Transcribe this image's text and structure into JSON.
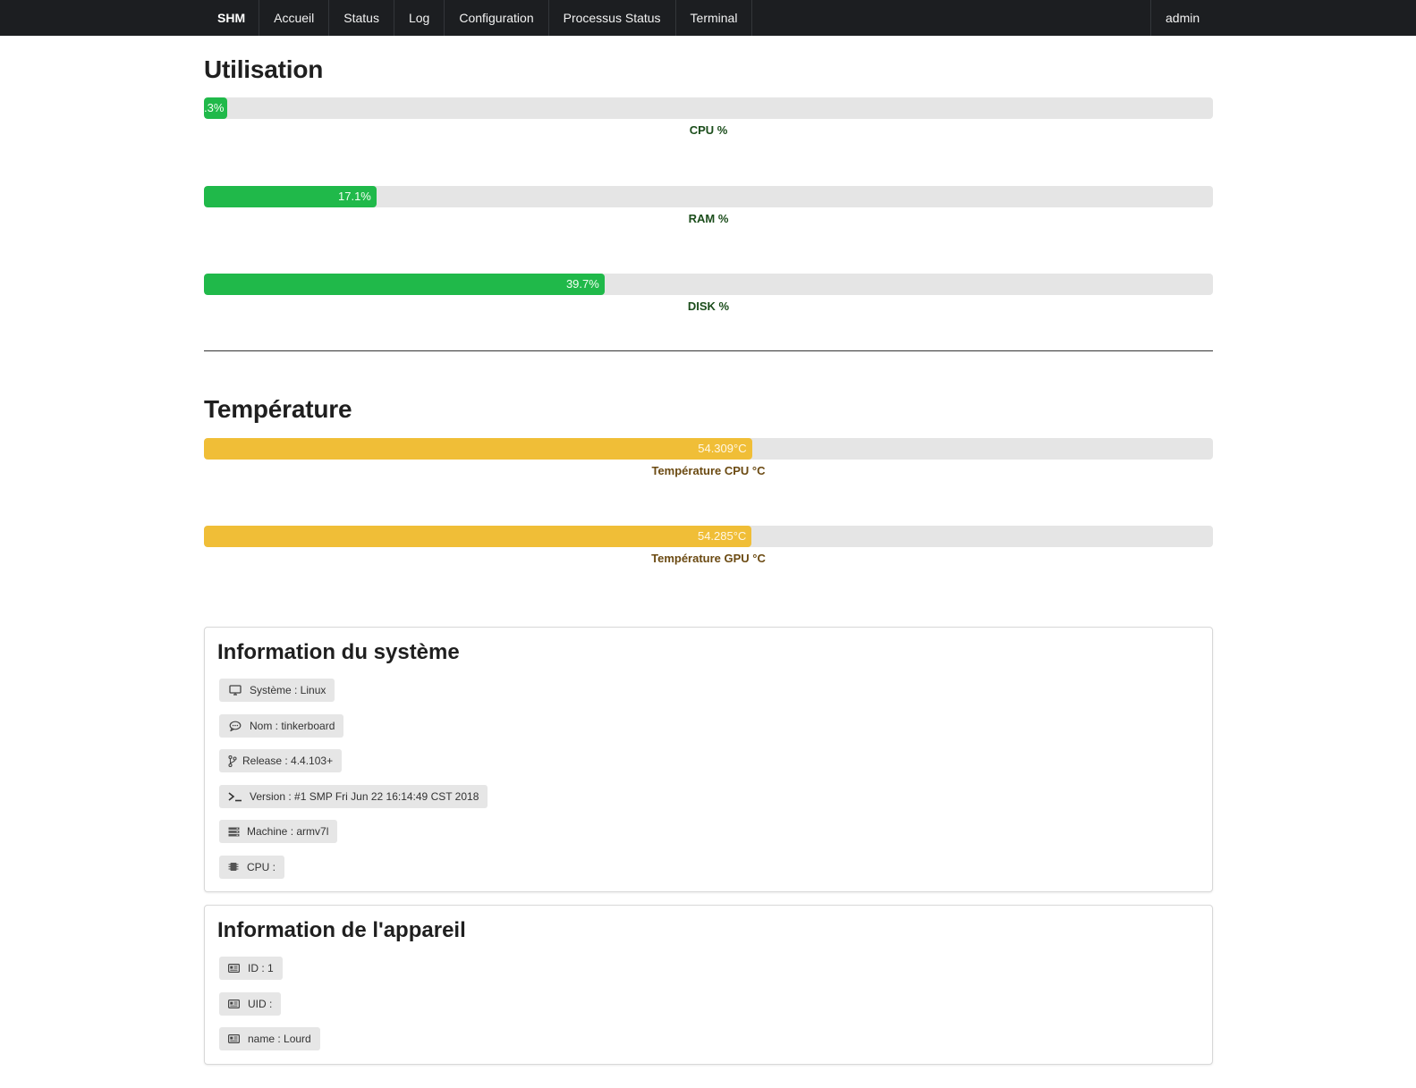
{
  "navbar": {
    "brand": "SHM",
    "items": [
      {
        "label": "Accueil"
      },
      {
        "label": "Status"
      },
      {
        "label": "Log"
      },
      {
        "label": "Configuration"
      },
      {
        "label": "Processus Status"
      },
      {
        "label": "Terminal"
      }
    ],
    "user": "admin"
  },
  "utilisation": {
    "title": "Utilisation",
    "cpu": {
      "percent": 2.3,
      "value_text": ".3%",
      "label": "CPU %"
    },
    "ram": {
      "percent": 17.1,
      "value_text": "17.1%",
      "label": "RAM %"
    },
    "disk": {
      "percent": 39.7,
      "value_text": "39.7%",
      "label": "DISK %"
    }
  },
  "temperature": {
    "title": "Température",
    "cpu": {
      "percent": 54.309,
      "value_text": "54.309°C",
      "label": "Température CPU °C"
    },
    "gpu": {
      "percent": 54.285,
      "value_text": "54.285°C",
      "label": "Température GPU °C"
    }
  },
  "system_info": {
    "title": "Information du système",
    "items": [
      {
        "icon": "monitor-icon",
        "text": "Système : Linux"
      },
      {
        "icon": "chat-bubble-icon",
        "text": "Nom : tinkerboard"
      },
      {
        "icon": "git-branch-icon",
        "text": "Release : 4.4.103+"
      },
      {
        "icon": "terminal-icon",
        "text": "Version : #1 SMP Fri Jun 22 16:14:49 CST 2018"
      },
      {
        "icon": "server-icon",
        "text": "Machine : armv7l"
      },
      {
        "icon": "chip-icon",
        "text": "CPU :"
      }
    ]
  },
  "device_info": {
    "title": "Information de l'appareil",
    "items": [
      {
        "icon": "id-card-icon",
        "text": "ID : 1"
      },
      {
        "icon": "id-card-icon",
        "text": "UID :"
      },
      {
        "icon": "id-card-icon",
        "text": "name : Lourd"
      }
    ]
  },
  "colors": {
    "navbar_bg": "#1c1e21",
    "usage_bar": "#20b94a",
    "temperature_bar": "#f0be37",
    "track": "#e5e5e5"
  }
}
